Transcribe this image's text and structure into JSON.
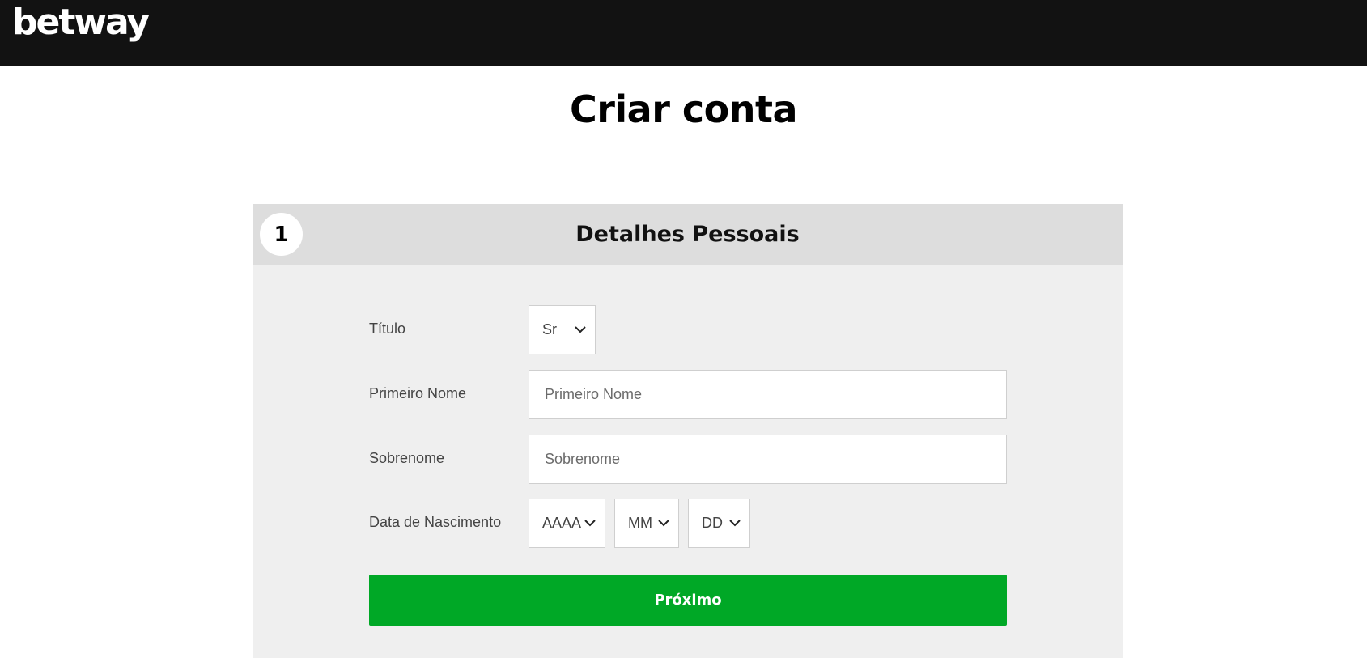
{
  "header": {
    "logo_text": "betway"
  },
  "page": {
    "title": "Criar conta"
  },
  "step": {
    "number": "1",
    "title": "Detalhes Pessoais"
  },
  "form": {
    "title_label": "Título",
    "title_value": "Sr",
    "first_name_label": "Primeiro Nome",
    "first_name_placeholder": "Primeiro Nome",
    "last_name_label": "Sobrenome",
    "last_name_placeholder": "Sobrenome",
    "dob_label": "Data de Nascimento",
    "dob_year": "AAAA",
    "dob_month": "MM",
    "dob_day": "DD",
    "next_button": "Próximo"
  },
  "colors": {
    "topbar": "#121212",
    "accent_green": "#00a826",
    "panel_bg": "#efefef",
    "panel_header_bg": "#dddddd"
  },
  "icons": {
    "dropdown": "chevron-down-icon"
  }
}
